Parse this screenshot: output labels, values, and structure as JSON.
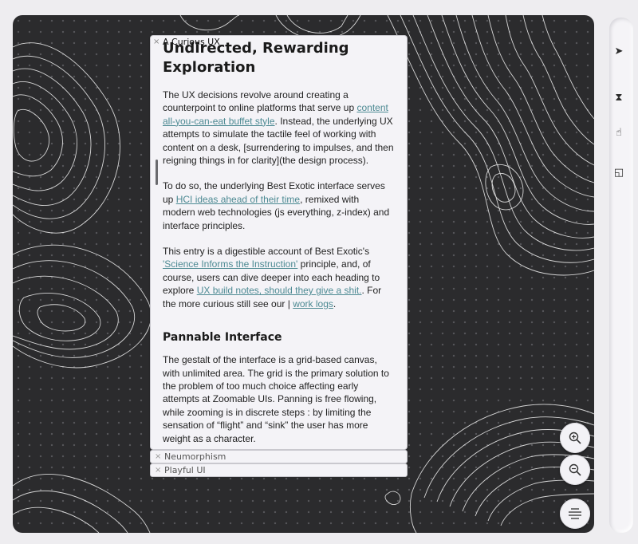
{
  "window": {
    "colors": {
      "canvas": "#2b2b2d",
      "panel": "#f4f3f7",
      "link": "#4d8a93",
      "contour": "#e9e9e9"
    }
  },
  "toolbar": {
    "items": [
      {
        "name": "cursor-icon",
        "glyph": "➤"
      },
      {
        "name": "hourglass-icon",
        "glyph": "⧗"
      },
      {
        "name": "hand-icon",
        "glyph": "☝"
      },
      {
        "name": "panel-icon",
        "glyph": "◱"
      }
    ]
  },
  "panel": {
    "tab_title": "A Curious UX",
    "close_glyph": "×",
    "heading": "Undirected, Rewarding Exploration",
    "p1": {
      "t1": "The UX decisions revolve around creating a counterpoint to online platforms that serve up ",
      "l1": "content all-you-can-eat buffet style",
      "t2": ". Instead, the underlying UX attempts to simulate the tactile feel of working with content on a desk, [surrendering to impulses, and then reigning things in for clarity](the design process)."
    },
    "p2": {
      "t1": "To do so, the underlying Best Exotic interface serves up ",
      "l1": "HCI ideas ahead of their time",
      "t2": ", remixed with modern web technologies (js everything, z-index) and interface principles."
    },
    "p3": {
      "t1": "This entry is a digestible account of Best Exotic's ",
      "l1": "'Science Informs the Instruction'",
      "t2": " principle, and, of course, users can dive deeper into each heading to explore ",
      "l2": "UX build notes, should they give a shit.",
      "t3": ". For the more curious still see our ",
      "bar": "|",
      "l3": "work logs",
      "t4": "."
    },
    "section_heading": "Pannable Interface",
    "p4": "The gestalt of the interface is a grid-based canvas, with unlimited area. The grid is the primary solution to the problem of too much choice affecting early attempts at Zoomable UIs. Panning is free flowing, while zooming is in discrete steps : by limiting the sensation of “flight” and “sink” the user has more weight as a character."
  },
  "stacked_tabs": [
    {
      "label": "Neumorphism"
    },
    {
      "label": "Playful UI"
    }
  ],
  "zoom": {
    "zoom_in": "zoom-in-icon",
    "zoom_out": "zoom-out-icon",
    "menu": "menu-icon"
  }
}
